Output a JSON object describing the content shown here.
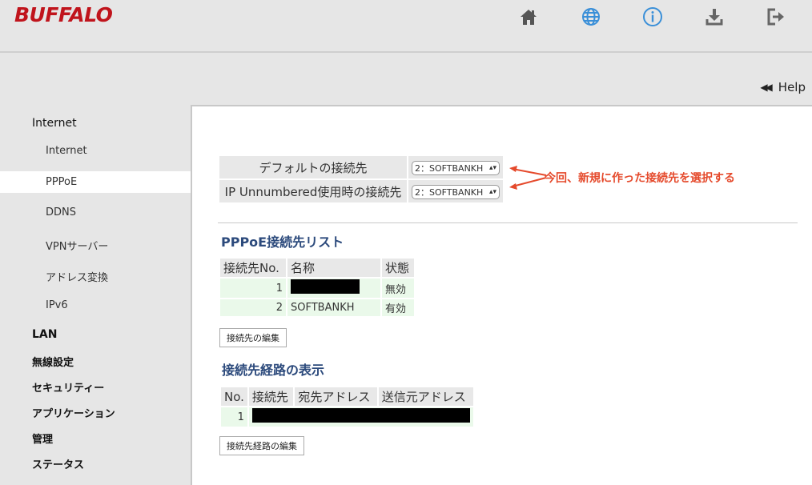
{
  "brand": {
    "logo": "BUFFALO",
    "brand_color": "#c0141c"
  },
  "top_icons": [
    {
      "name": "home-icon",
      "color": "#555"
    },
    {
      "name": "globe-icon",
      "color": "#3a8fd8"
    },
    {
      "name": "info-icon",
      "color": "#3a8fd8"
    },
    {
      "name": "download-icon",
      "color": "#666"
    },
    {
      "name": "logout-icon",
      "color": "#666"
    }
  ],
  "help": {
    "label": "Help"
  },
  "sidebar": {
    "internet_section": "Internet",
    "internet_items": [
      "Internet",
      "PPPoE",
      "DDNS",
      "VPNサーバー",
      "アドレス変換",
      "IPv6"
    ],
    "active_item": "PPPoE",
    "sections": [
      "LAN",
      "無線設定",
      "セキュリティー",
      "アプリケーション",
      "管理",
      "ステータス"
    ]
  },
  "config": {
    "default_label": "デフォルトの接続先",
    "default_value": "2：SOFTBANKH",
    "unnumbered_label": "IP Unnumbered使用時の接続先",
    "unnumbered_value": "2：SOFTBANKH"
  },
  "annotation": "今回、新規に作った接続先を選択する",
  "pppoe_list": {
    "title": "PPPoE接続先リスト",
    "headers": [
      "接続先No.",
      "名称",
      "状態"
    ],
    "rows": [
      {
        "no": "1",
        "name": "",
        "status": "無効"
      },
      {
        "no": "2",
        "name": "SOFTBANKH",
        "status": "有効"
      }
    ],
    "edit_button": "接続先の編集"
  },
  "route_list": {
    "title": "接続先経路の表示",
    "headers": [
      "No.",
      "接続先",
      "宛先アドレス",
      "送信元アドレス"
    ],
    "rows": [
      {
        "no": "1"
      }
    ],
    "edit_button": "接続先経路の編集"
  }
}
